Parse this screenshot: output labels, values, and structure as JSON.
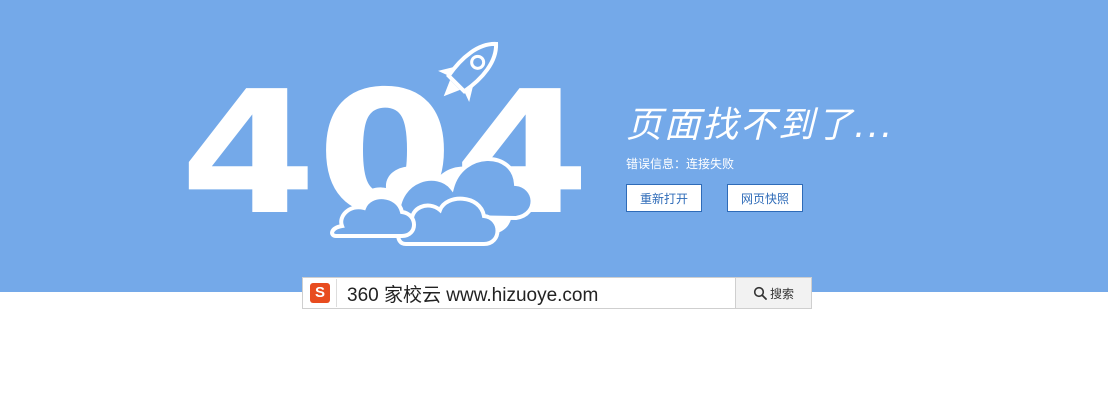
{
  "error_page": {
    "code": "404",
    "title": "页面找不到了...",
    "error_label": "错误信息：",
    "error_message": "连接失败",
    "reopen_button": "重新打开",
    "snapshot_button": "网页快照"
  },
  "search": {
    "engine_logo": "S",
    "query": "360 家校云 www.hizuoye.com",
    "button_label": "搜索"
  },
  "colors": {
    "banner_bg": "#74a9e9",
    "button_border": "#2e6bb8",
    "logo_bg": "#e84c1f"
  },
  "icons": [
    "rocket-icon",
    "cloud-icon",
    "search-icon"
  ]
}
